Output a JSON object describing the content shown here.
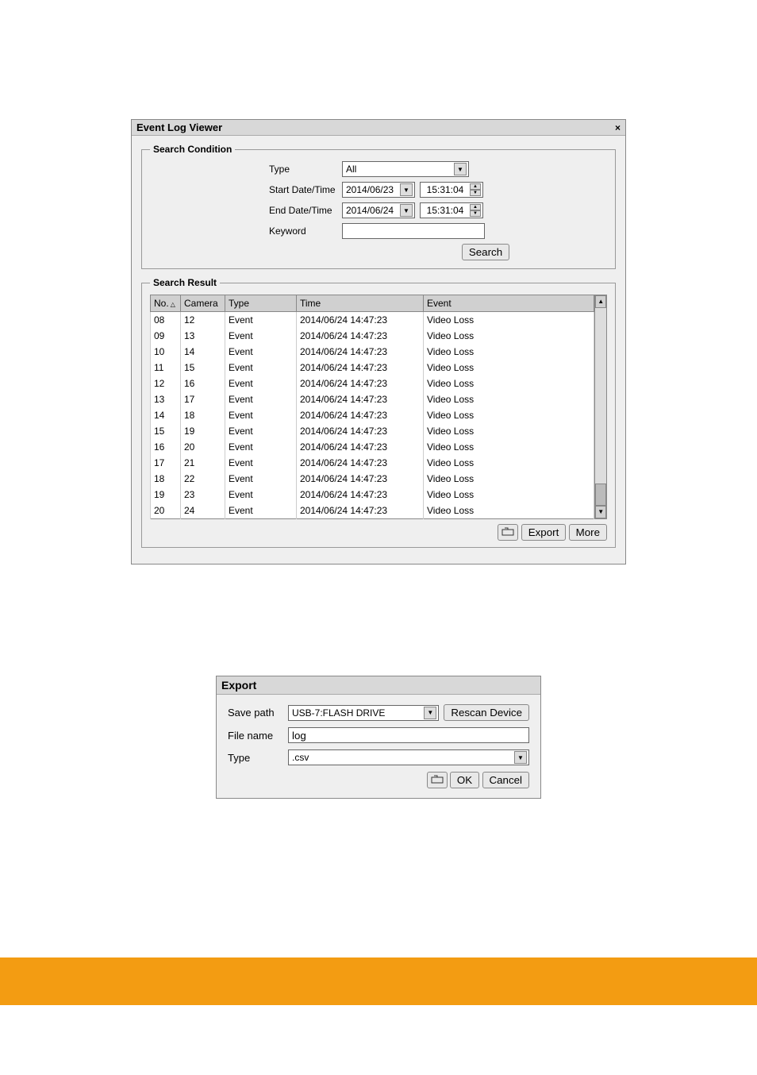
{
  "viewer": {
    "title": "Event Log Viewer",
    "condition": {
      "legend": "Search Condition",
      "type_label": "Type",
      "type_value": "All",
      "start_label": "Start Date/Time",
      "start_date": "2014/06/23",
      "start_time": "15:31:04",
      "end_label": "End Date/Time",
      "end_date": "2014/06/24",
      "end_time": "15:31:04",
      "keyword_label": "Keyword",
      "keyword_value": "",
      "search_btn": "Search"
    },
    "result": {
      "legend": "Search Result",
      "headers": {
        "no": "No.",
        "camera": "Camera",
        "type": "Type",
        "time": "Time",
        "event": "Event"
      },
      "rows": [
        {
          "no": "08",
          "camera": "12",
          "type": "Event",
          "time": "2014/06/24 14:47:23",
          "event": "Video Loss"
        },
        {
          "no": "09",
          "camera": "13",
          "type": "Event",
          "time": "2014/06/24 14:47:23",
          "event": "Video Loss"
        },
        {
          "no": "10",
          "camera": "14",
          "type": "Event",
          "time": "2014/06/24 14:47:23",
          "event": "Video Loss"
        },
        {
          "no": "11",
          "camera": "15",
          "type": "Event",
          "time": "2014/06/24 14:47:23",
          "event": "Video Loss"
        },
        {
          "no": "12",
          "camera": "16",
          "type": "Event",
          "time": "2014/06/24 14:47:23",
          "event": "Video Loss"
        },
        {
          "no": "13",
          "camera": "17",
          "type": "Event",
          "time": "2014/06/24 14:47:23",
          "event": "Video Loss"
        },
        {
          "no": "14",
          "camera": "18",
          "type": "Event",
          "time": "2014/06/24 14:47:23",
          "event": "Video Loss"
        },
        {
          "no": "15",
          "camera": "19",
          "type": "Event",
          "time": "2014/06/24 14:47:23",
          "event": "Video Loss"
        },
        {
          "no": "16",
          "camera": "20",
          "type": "Event",
          "time": "2014/06/24 14:47:23",
          "event": "Video Loss"
        },
        {
          "no": "17",
          "camera": "21",
          "type": "Event",
          "time": "2014/06/24 14:47:23",
          "event": "Video Loss"
        },
        {
          "no": "18",
          "camera": "22",
          "type": "Event",
          "time": "2014/06/24 14:47:23",
          "event": "Video Loss"
        },
        {
          "no": "19",
          "camera": "23",
          "type": "Event",
          "time": "2014/06/24 14:47:23",
          "event": "Video Loss"
        },
        {
          "no": "20",
          "camera": "24",
          "type": "Event",
          "time": "2014/06/24 14:47:23",
          "event": "Video Loss"
        }
      ],
      "export_btn": "Export",
      "more_btn": "More"
    }
  },
  "export": {
    "title": "Export",
    "save_path_label": "Save path",
    "save_path_value": "USB-7:FLASH DRIVE",
    "rescan_btn": "Rescan Device",
    "filename_label": "File name",
    "filename_value": "log",
    "type_label": "Type",
    "type_value": ".csv",
    "ok_btn": "OK",
    "cancel_btn": "Cancel"
  }
}
